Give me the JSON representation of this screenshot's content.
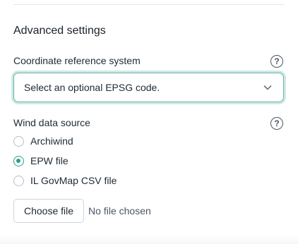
{
  "advanced": {
    "title": "Advanced settings"
  },
  "crs": {
    "label": "Coordinate reference system",
    "help_glyph": "?",
    "select_placeholder": "Select an optional EPSG code."
  },
  "wind": {
    "label": "Wind data source",
    "help_glyph": "?",
    "options": [
      {
        "label": "Archiwind",
        "checked": false
      },
      {
        "label": "EPW file",
        "checked": true
      },
      {
        "label": "IL GovMap CSV file",
        "checked": false
      }
    ]
  },
  "file": {
    "button_label": "Choose file",
    "status": "No file chosen"
  },
  "colors": {
    "accent": "#2f9c8c",
    "focus_ring": "#cfe9e3",
    "border": "#d1d5db"
  },
  "icons": {
    "help": "question-circle-icon",
    "chevron": "chevron-down-icon"
  }
}
